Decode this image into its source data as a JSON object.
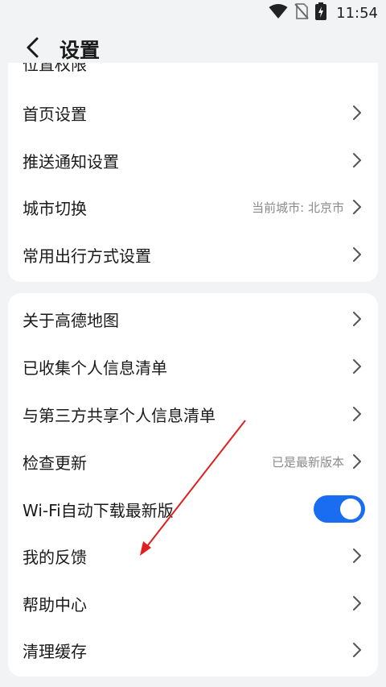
{
  "status_bar": {
    "time": "11:54",
    "icons": [
      "wifi-icon",
      "no-sim-icon",
      "battery-charging-icon"
    ]
  },
  "header": {
    "title": "设置",
    "back_icon": "chevron-left-icon"
  },
  "partial_item": "位置权限",
  "group1": [
    {
      "label": "首页设置",
      "value": ""
    },
    {
      "label": "推送通知设置",
      "value": ""
    },
    {
      "label": "城市切换",
      "value": "当前城市: 北京市"
    },
    {
      "label": "常用出行方式设置",
      "value": ""
    }
  ],
  "group2": [
    {
      "label": "关于高德地图",
      "value": ""
    },
    {
      "label": "已收集个人信息清单",
      "value": ""
    },
    {
      "label": "与第三方共享个人信息清单",
      "value": ""
    },
    {
      "label": "检查更新",
      "value": "已是最新版本"
    },
    {
      "label": "Wi-Fi自动下载最新版",
      "value": "",
      "toggle": true
    },
    {
      "label": "我的反馈",
      "value": ""
    },
    {
      "label": "帮助中心",
      "value": ""
    },
    {
      "label": "清理缓存",
      "value": ""
    }
  ],
  "colors": {
    "background": "#f2f3f5",
    "card": "#ffffff",
    "toggle_on": "#1a6cf0",
    "annotation_arrow": "#e02020",
    "secondary_text": "#8a8a8a"
  }
}
